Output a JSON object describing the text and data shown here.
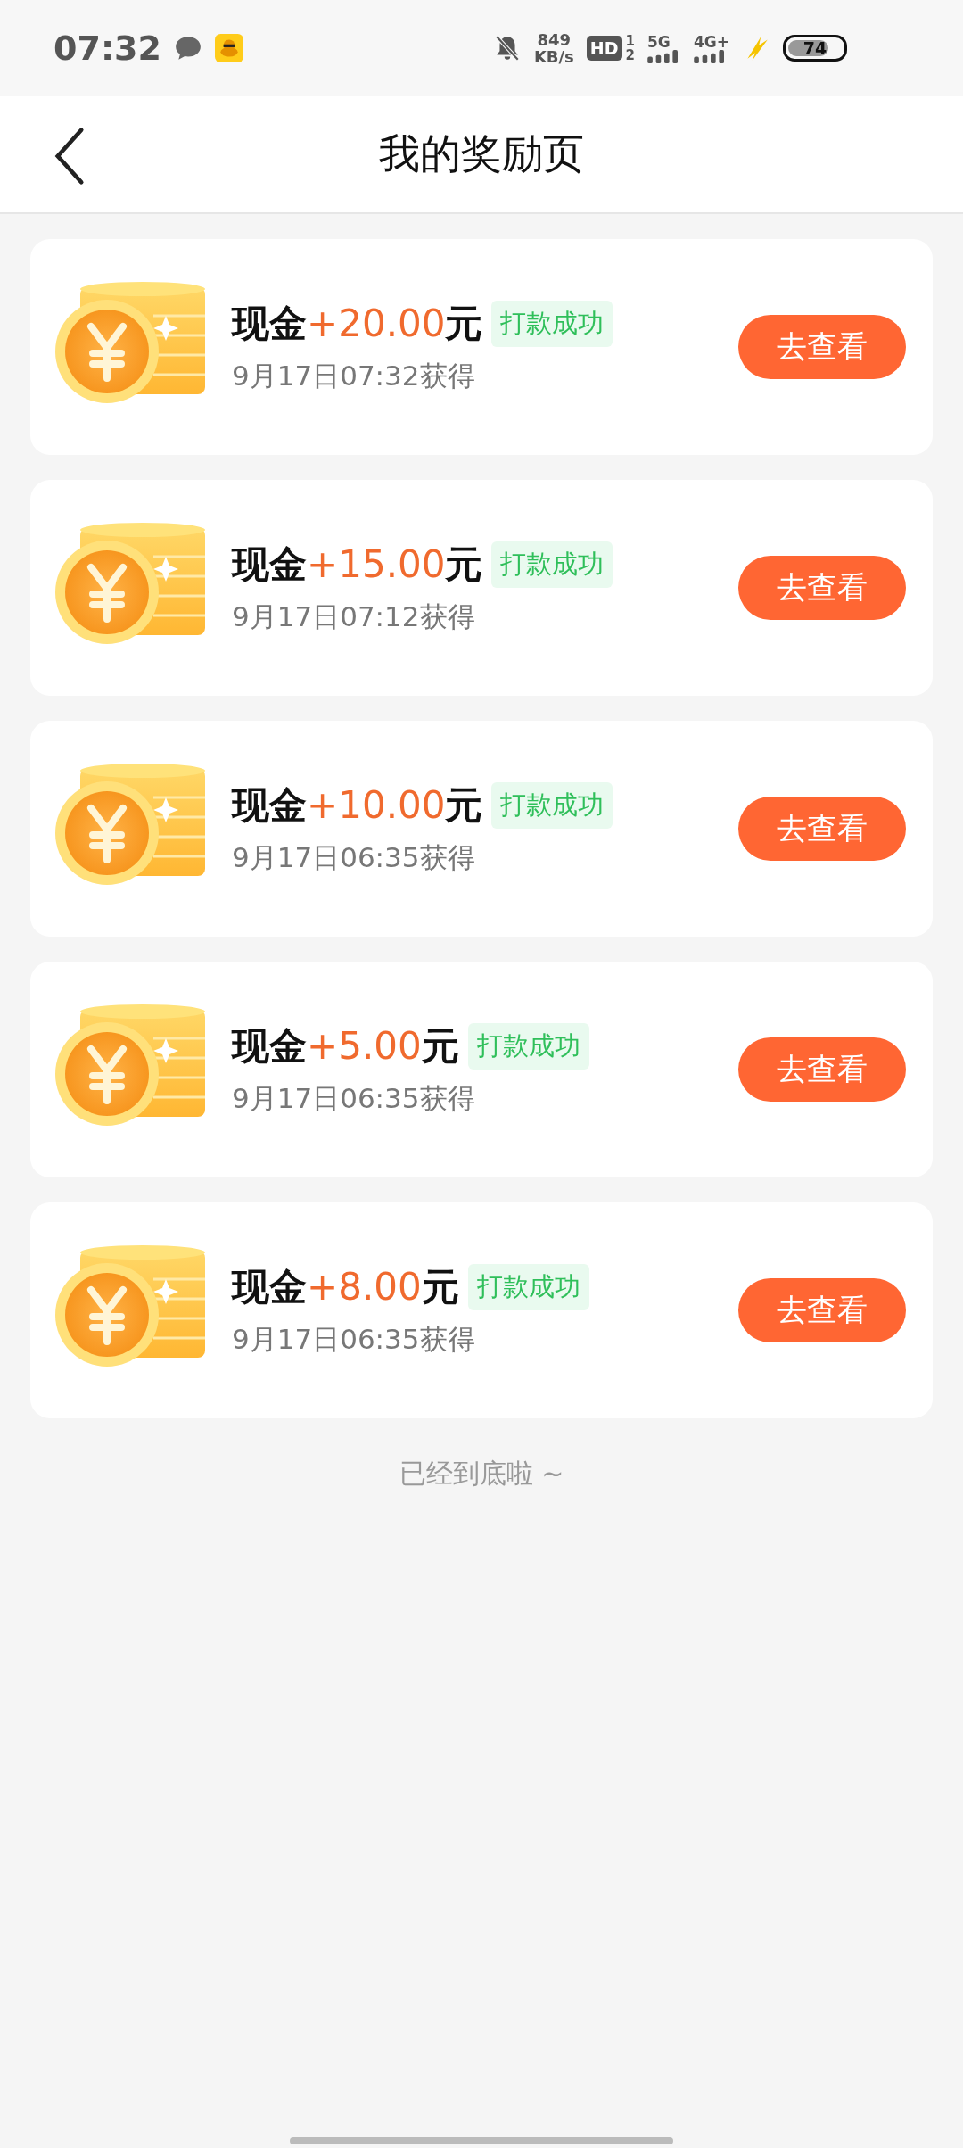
{
  "status_bar": {
    "time": "07:32",
    "net_speed": "849",
    "net_unit": "KB/s",
    "hd": "HD",
    "sim_1": "1",
    "sim_2": "2",
    "network_1": "5G",
    "network_2": "4G+",
    "battery": "74"
  },
  "nav": {
    "title": "我的奖励页"
  },
  "rewards": [
    {
      "label": "现金",
      "amount": "+20.00",
      "unit": "元",
      "status": "打款成功",
      "time": "9月17日07:32获得",
      "action": "去查看"
    },
    {
      "label": "现金",
      "amount": "+15.00",
      "unit": "元",
      "status": "打款成功",
      "time": "9月17日07:12获得",
      "action": "去查看"
    },
    {
      "label": "现金",
      "amount": "+10.00",
      "unit": "元",
      "status": "打款成功",
      "time": "9月17日06:35获得",
      "action": "去查看"
    },
    {
      "label": "现金",
      "amount": "+5.00",
      "unit": "元",
      "status": "打款成功",
      "time": "9月17日06:35获得",
      "action": "去查看"
    },
    {
      "label": "现金",
      "amount": "+8.00",
      "unit": "元",
      "status": "打款成功",
      "time": "9月17日06:35获得",
      "action": "去查看"
    }
  ],
  "footer": "已经到底啦 ~"
}
